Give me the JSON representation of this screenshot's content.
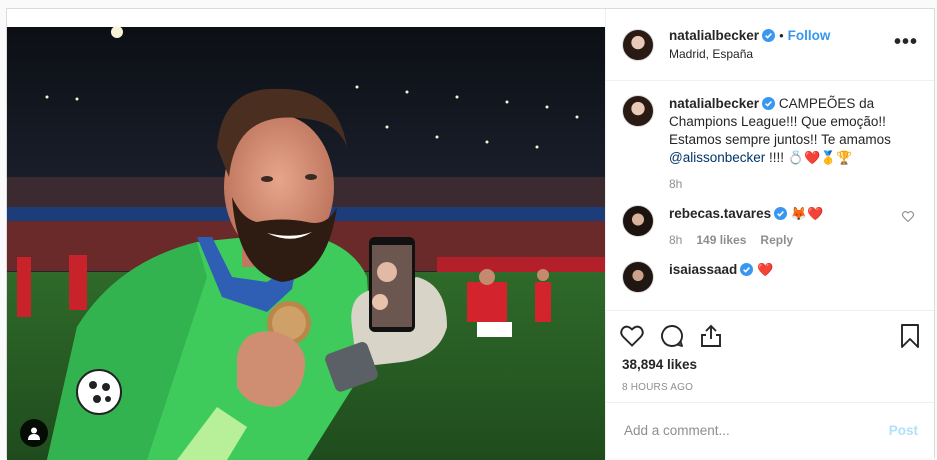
{
  "header": {
    "username": "natalialbecker",
    "dot": "•",
    "follow_label": "Follow",
    "location": "Madrid, España",
    "more_label": "•••"
  },
  "caption": {
    "username": "natalialbecker",
    "text": "CAMPEÕES da Champions League!!! Que emoção!! Estamos sempre juntos!! Te amamos",
    "mention": "@alissonbecker",
    "suffix": "!!!!",
    "emojis": "💍❤️🥇🏆",
    "time": "8h"
  },
  "comments": [
    {
      "username": "rebecas.tavares",
      "emojis": "🦊❤️",
      "time": "8h",
      "likes": "149 likes",
      "reply_label": "Reply"
    },
    {
      "username": "isaiassaad",
      "emojis": "❤️"
    }
  ],
  "likes_count": "38,894 likes",
  "timestamp": "8 HOURS AGO",
  "add_comment": {
    "placeholder": "Add a comment...",
    "post_label": "Post"
  },
  "colors": {
    "accent": "#3897f0",
    "verified": "#3897f0",
    "post_disabled": "#b2dffc"
  },
  "icons": {
    "like": "heart-icon",
    "comment": "comment-icon",
    "share": "share-icon",
    "save": "bookmark-icon",
    "tag": "user-tag-icon"
  }
}
